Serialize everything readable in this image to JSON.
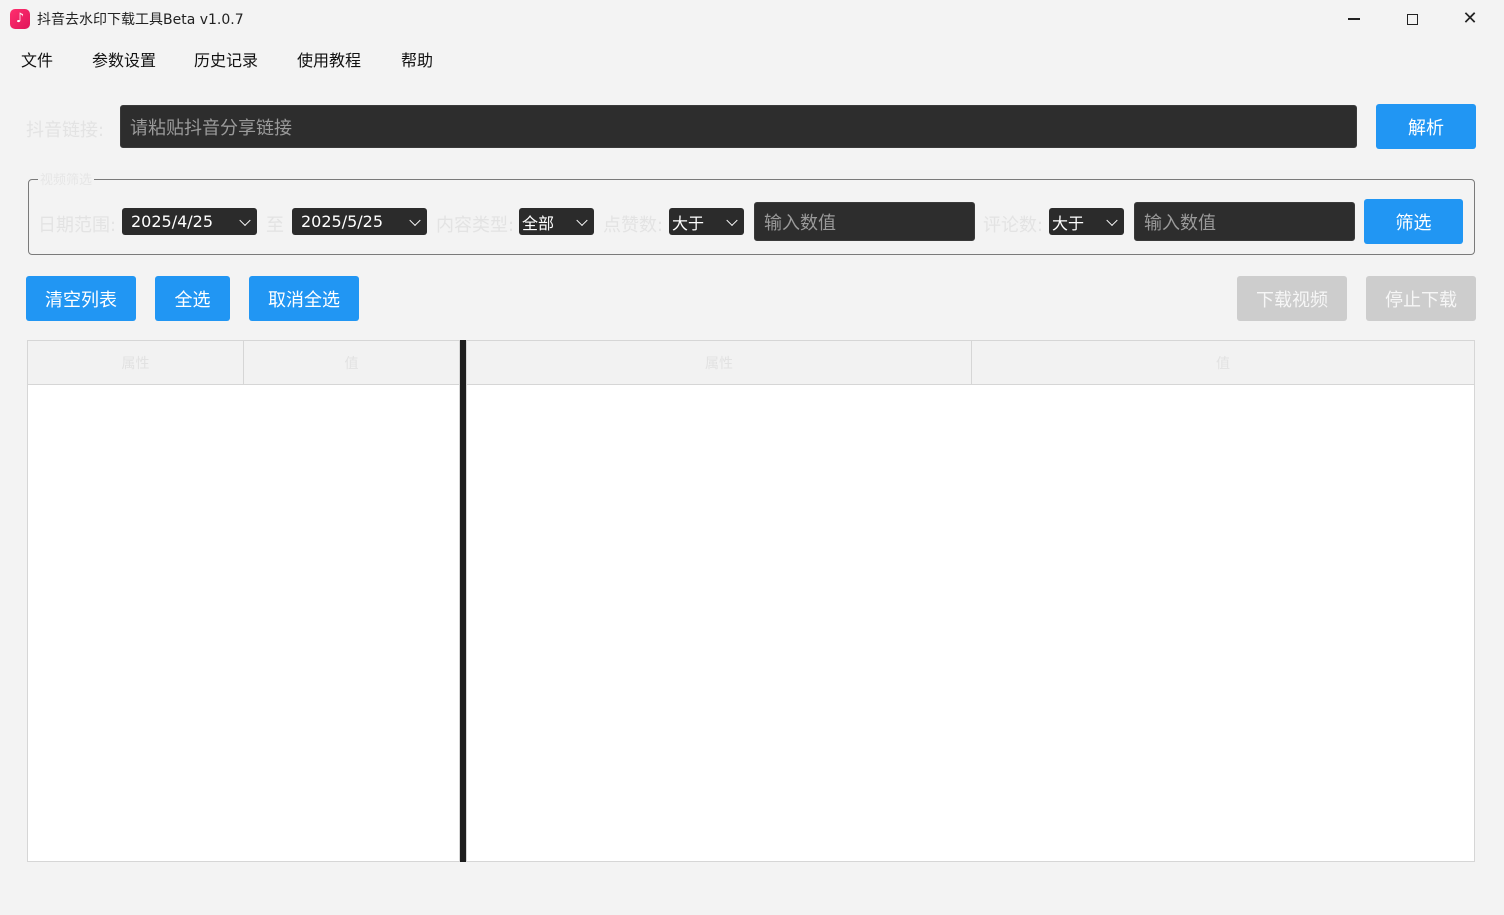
{
  "window": {
    "title": "抖音去水印下载工具Beta v1.0.7",
    "icon": "tiktok-note-icon",
    "controls": {
      "minimize": "minimize-icon",
      "maximize": "maximize-icon",
      "close": "close-icon",
      "close_glyph": "✕"
    }
  },
  "menu": [
    "文件",
    "参数设置",
    "历史记录",
    "使用教程",
    "帮助"
  ],
  "link": {
    "label": "抖音链接:",
    "placeholder": "请粘贴抖音分享链接",
    "parse_button": "解析"
  },
  "filter": {
    "group_title": "视频筛选",
    "date_label": "日期范围:",
    "date_from": "2025/4/25",
    "to_label": "至",
    "date_to": "2025/5/25",
    "content_type_label": "内容类型:",
    "content_type": "全部",
    "likes_label": "点赞数:",
    "likes_op": "大于",
    "likes_placeholder": "输入数值",
    "comments_label": "评论数:",
    "comments_op": "大于",
    "comments_placeholder": "输入数值",
    "filter_button": "筛选"
  },
  "actions": {
    "clear_list": "清空列表",
    "select_all": "全选",
    "deselect_all": "取消全选",
    "download_video": "下载视频",
    "stop_download": "停止下载"
  },
  "left_table": {
    "columns": [
      "属性",
      "值"
    ]
  },
  "right_table": {
    "columns": [
      "属性",
      "值"
    ]
  },
  "colors": {
    "accent": "#2196f3",
    "disabled": "#cdcdcd",
    "dark_input": "#2d2d2d"
  }
}
